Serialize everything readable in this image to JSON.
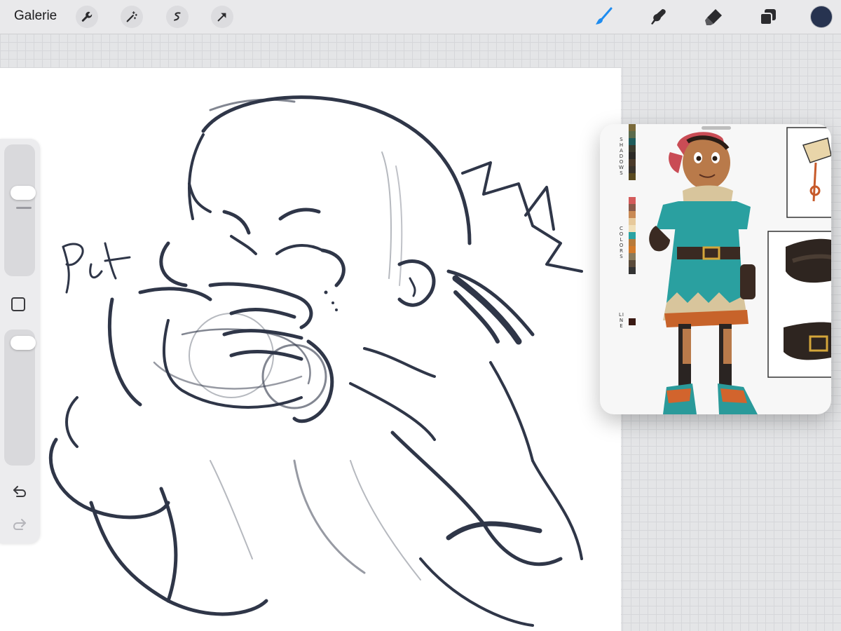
{
  "toolbar": {
    "gallery_label": "Galerie",
    "left_tools": [
      "wrench-icon",
      "magic-wand-icon",
      "selection-icon",
      "transform-arrow-icon"
    ],
    "right_tools": [
      "brush-icon",
      "smudge-icon",
      "eraser-icon",
      "layers-icon"
    ],
    "active_tool": "brush-icon",
    "active_color": "#273350",
    "accent_color": "#1e8cf0"
  },
  "sidebar": {
    "brush_size_icon": "brush-size-slider",
    "modify_icon": "eyedropper-square-icon",
    "opacity_icon": "opacity-slider",
    "undo_icon": "undo-icon",
    "redo_icon": "redo-icon"
  },
  "reference": {
    "palette_labels": {
      "shadows": "SHADOWS",
      "colors": "COLORS",
      "line": "LINE"
    },
    "shadow_swatches": [
      "#7a6a3a",
      "#5b6b4b",
      "#1f5c5c",
      "#3b3b2e",
      "#2c2a27",
      "#4a3a2a",
      "#3a342c",
      "#5a4a20"
    ],
    "color_swatches": [
      "#d45b5b",
      "#8a5a4a",
      "#c98a55",
      "#e7c99b",
      "#f1dfb8",
      "#2aa3a3",
      "#b77a3a",
      "#d27a2a",
      "#8a7a5a",
      "#5a4a3a",
      "#333333"
    ],
    "line_swatch": "#3a1a14"
  }
}
